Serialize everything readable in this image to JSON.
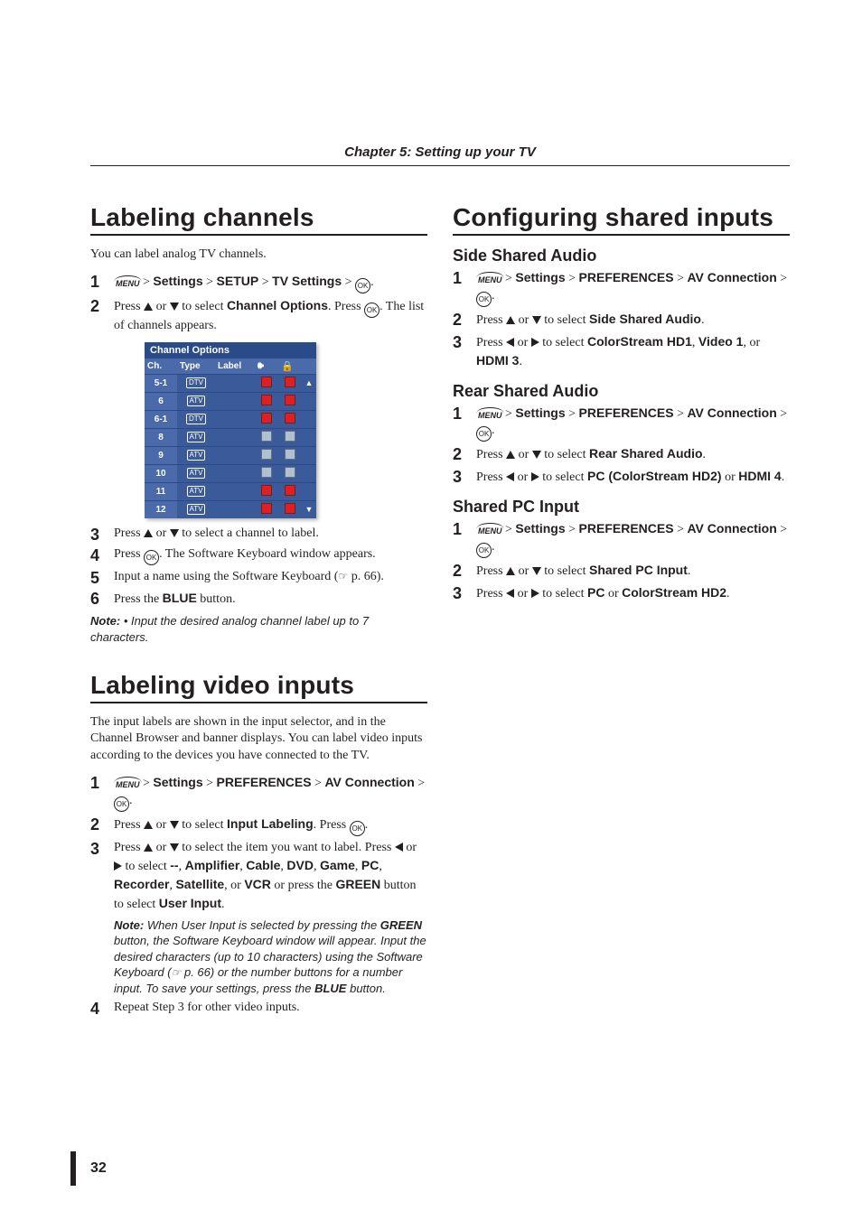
{
  "chapter_title": "Chapter 5: Setting up your TV",
  "page_number": "32",
  "left_col": {
    "section1": {
      "title": "Labeling channels",
      "intro": "You can label analog TV channels.",
      "step1_settings": "Settings",
      "step1_setup": "SETUP",
      "step1_tv": "TV Settings",
      "step2_a": "Press ",
      "step2_b": " or ",
      "step2_c": " to select ",
      "step2_bold": "Channel Options",
      "step2_d": ". Press ",
      "step2_e": ". The list of channels appears.",
      "step3_a": "Press ",
      "step3_b": " or ",
      "step3_c": " to select a channel to label.",
      "step4_a": "Press ",
      "step4_b": ". The Software Keyboard window appears.",
      "step5_a": "Input a name using the Software Keyboard (",
      "step5_b": " p. 66).",
      "step6_a": "Press the ",
      "step6_bold": "BLUE",
      "step6_b": " button.",
      "note_label": "Note:",
      "note_body": " • Input the desired analog channel label up to 7 characters.",
      "screenshot": {
        "title": "Channel Options",
        "headers": {
          "ch": "Ch.",
          "type": "Type",
          "label": "Label"
        },
        "rows": [
          {
            "ch": "5-1",
            "type": "DTV",
            "s1": "on",
            "s2": "on"
          },
          {
            "ch": "6",
            "type": "ATV",
            "s1": "on",
            "s2": "on"
          },
          {
            "ch": "6-1",
            "type": "DTV",
            "s1": "on",
            "s2": "on"
          },
          {
            "ch": "8",
            "type": "ATV",
            "s1": "off",
            "s2": "off"
          },
          {
            "ch": "9",
            "type": "ATV",
            "s1": "off",
            "s2": "off"
          },
          {
            "ch": "10",
            "type": "ATV",
            "s1": "off",
            "s2": "off"
          },
          {
            "ch": "11",
            "type": "ATV",
            "s1": "on",
            "s2": "on"
          },
          {
            "ch": "12",
            "type": "ATV",
            "s1": "on",
            "s2": "on"
          }
        ]
      }
    },
    "section2": {
      "title": "Labeling video inputs",
      "intro": "The input labels are shown in the input selector, and in the Channel Browser and banner displays. You can label video inputs according to the devices you have connected to the TV.",
      "step1_settings": "Settings",
      "step1_pref": "PREFERENCES",
      "step1_av": "AV Connection",
      "step2_a": "Press ",
      "step2_b": " or ",
      "step2_c": " to select ",
      "step2_bold": "Input Labeling",
      "step2_d": ". Press ",
      "step3_a": "Press ",
      "step3_b": " or ",
      "step3_c": " to select the item you want to label. Press ",
      "step3_d": " or ",
      "step3_e": " to select ",
      "step3_dashes": "--",
      "step3_amp": "Amplifier",
      "step3_cable": "Cable",
      "step3_dvd": "DVD",
      "step3_game": "Game",
      "step3_pc": "PC",
      "step3_rec": "Recorder",
      "step3_sat": "Satellite",
      "step3_or": ", or ",
      "step3_vcr": "VCR",
      "step3_orpress": " or press the ",
      "step3_green": "GREEN",
      "step3_tosel": " button to select ",
      "step3_userinput": "User Input",
      "note_label": "Note:",
      "note_body_a": " When User Input is selected by pressing the ",
      "note_green": "GREEN",
      "note_body_b": " button, the Software Keyboard window will appear. Input the desired characters (up to 10 characters) using the Software Keyboard (",
      "note_body_c": " p. 66) or the number buttons for a number input. To save your settings, press the ",
      "note_blue": "BLUE",
      "note_body_d": " button.",
      "step4": "Repeat Step 3 for other video inputs."
    }
  },
  "right_col": {
    "section1": {
      "title": "Configuring shared inputs",
      "sub1": {
        "title": "Side Shared Audio",
        "step1_settings": "Settings",
        "step1_pref": "PREFERENCES",
        "step1_av": "AV Connection",
        "step2_a": "Press ",
        "step2_b": " or ",
        "step2_c": " to select ",
        "step2_bold": "Side Shared Audio",
        "step3_a": "Press ",
        "step3_b": " or ",
        "step3_c": " to select ",
        "step3_cs": "ColorStream HD1",
        "step3_v1": "Video 1",
        "step3_or": ", or ",
        "step3_h3": "HDMI 3"
      },
      "sub2": {
        "title": "Rear Shared Audio",
        "step1_settings": "Settings",
        "step1_pref": "PREFERENCES",
        "step1_av": "AV Connection",
        "step2_a": "Press ",
        "step2_b": " or ",
        "step2_c": " to select ",
        "step2_bold": "Rear Shared Audio",
        "step3_a": "Press ",
        "step3_b": " or ",
        "step3_c": " to select ",
        "step3_pc": "PC (ColorStream HD2)",
        "step3_or": " or ",
        "step3_h4": "HDMI 4"
      },
      "sub3": {
        "title": "Shared PC Input",
        "step1_settings": "Settings",
        "step1_pref": "PREFERENCES",
        "step1_av": "AV Connection",
        "step2_a": "Press ",
        "step2_b": " or ",
        "step2_c": " to select ",
        "step2_bold": "Shared PC Input",
        "step3_a": "Press ",
        "step3_b": " or ",
        "step3_c": " to select ",
        "step3_pc": "PC",
        "step3_or": " or ",
        "step3_cs": "ColorStream HD2"
      }
    }
  }
}
